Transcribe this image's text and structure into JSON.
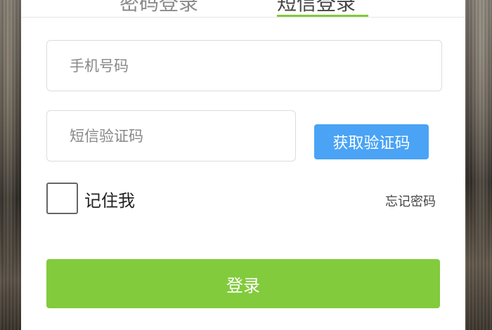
{
  "tabs": {
    "password_login": "密码登录",
    "sms_login": "短信登录",
    "active": "sms_login",
    "accent_color": "#82c93a"
  },
  "form": {
    "phone": {
      "placeholder": "手机号码",
      "value": ""
    },
    "sms_code": {
      "placeholder": "短信验证码",
      "value": ""
    },
    "get_code_button": "获取验证码",
    "remember_me": {
      "label": "记住我",
      "checked": false
    },
    "forgot_password": "忘记密码",
    "login_button": "登录"
  },
  "colors": {
    "get_code_button": "#4aa3f5",
    "login_button": "#82cb3c"
  }
}
